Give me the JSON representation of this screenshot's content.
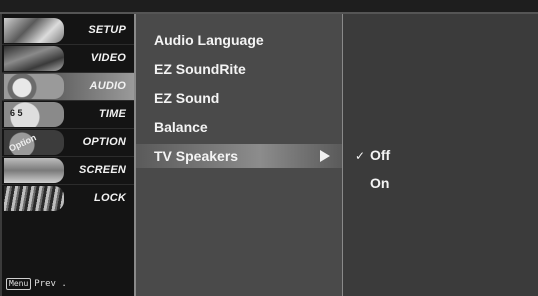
{
  "sidebar": {
    "items": [
      {
        "label": "SETUP",
        "icon": "setup-icon"
      },
      {
        "label": "VIDEO",
        "icon": "video-icon"
      },
      {
        "label": "AUDIO",
        "icon": "audio-icon",
        "active": true
      },
      {
        "label": "TIME",
        "icon": "time-icon",
        "thumb_text": "6 5"
      },
      {
        "label": "OPTION",
        "icon": "option-icon",
        "thumb_text": "Option"
      },
      {
        "label": "SCREEN",
        "icon": "screen-icon"
      },
      {
        "label": "LOCK",
        "icon": "lock-icon"
      }
    ],
    "footer": {
      "key": "Menu",
      "label": "Prev ."
    }
  },
  "submenu": {
    "items": [
      {
        "label": "Audio Language"
      },
      {
        "label": "EZ SoundRite"
      },
      {
        "label": "EZ Sound"
      },
      {
        "label": "Balance"
      },
      {
        "label": "TV Speakers",
        "active": true
      }
    ]
  },
  "options": {
    "items": [
      {
        "label": "Off",
        "selected": true,
        "mark": "✓"
      },
      {
        "label": "On",
        "selected": false
      }
    ]
  }
}
